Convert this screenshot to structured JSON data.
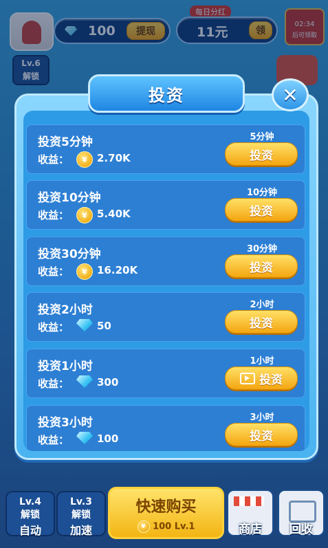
{
  "hud": {
    "gems": "100",
    "withdraw_label": "提现",
    "daily_bonus_label": "每日分红",
    "bonus_amount": "11元",
    "claim_label": "领",
    "timer": "02:34",
    "timer_caption": "后可领取",
    "level_unlock": {
      "level": "Lv.6",
      "label": "解锁"
    }
  },
  "modal": {
    "title": "投资",
    "close_glyph": "✕",
    "earnings_label": "收益：",
    "coin_glyph": "¥",
    "items": [
      {
        "name": "投资5分钟",
        "duration": "5分钟",
        "value": "2.70K",
        "currency": "coin",
        "button": "投资",
        "video": false
      },
      {
        "name": "投资10分钟",
        "duration": "10分钟",
        "value": "5.40K",
        "currency": "coin",
        "button": "投资",
        "video": false
      },
      {
        "name": "投资30分钟",
        "duration": "30分钟",
        "value": "16.20K",
        "currency": "coin",
        "button": "投资",
        "video": false
      },
      {
        "name": "投资2小时",
        "duration": "2小时",
        "value": "50",
        "currency": "gem",
        "button": "投资",
        "video": false
      },
      {
        "name": "投资1小时",
        "duration": "1小时",
        "value": "300",
        "currency": "gem",
        "button": "投资",
        "video": true
      },
      {
        "name": "投资3小时",
        "duration": "3小时",
        "value": "100",
        "currency": "gem",
        "button": "投资",
        "video": false
      }
    ]
  },
  "bottom": {
    "auto": {
      "level": "Lv.4",
      "label": "解锁",
      "caption": "自动"
    },
    "speed": {
      "level": "Lv.3",
      "label": "解锁",
      "caption": "加速"
    },
    "quick_buy": {
      "label": "快速购买",
      "price": "100",
      "level": "Lv.1"
    },
    "shop": "商店",
    "recycle": "回收"
  },
  "colors": {
    "accent": "#2e9be6",
    "button": "#f4a611",
    "panel": "#2d7fd4"
  }
}
